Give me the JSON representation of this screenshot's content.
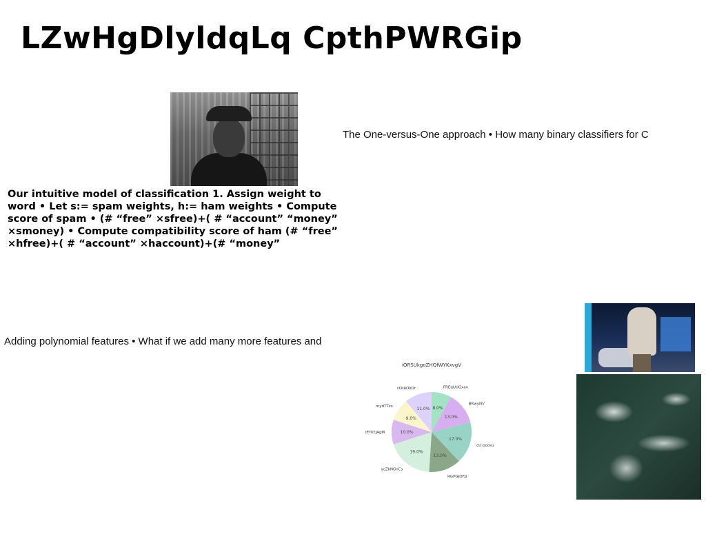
{
  "slide": {
    "title": "LZwHgDlyldqLq CpthPWRGip",
    "bold_paragraph": "Our intuitive model of classification 1. Assign weight to word • Let s:= spam weights, h:= ham weights • Compute score of spam • (# “free” ×sfree)+( # “account” “money” ×smoney) • Compute compatibility score of ham (# “free” ×hfree)+( # “account” ×haccount)+(# “money”",
    "text_ovo": "The One-versus-One approach • How many binary classifiers for C",
    "text_poly": "Adding polynomial features • What if we add many more features and"
  },
  "chart_data": {
    "type": "pie",
    "title": "iORSUkgoZHQfWYKxvgV",
    "slices": [
      {
        "label": "FREqUUGxav",
        "value": 8.0,
        "color": "#a3e3c4"
      },
      {
        "label": "BRwyNV",
        "value": 13.0,
        "color": "#d7aef0"
      },
      {
        "label": "cU  poosu",
        "value": 17.0,
        "color": "#99d3c6"
      },
      {
        "label": "RGPGJOFJJ",
        "value": 13.0,
        "color": "#8aa78a"
      },
      {
        "label": "ycZkNGnCs",
        "value": 19.0,
        "color": "#d4efdd"
      },
      {
        "label": "DFTKTJAgM",
        "value": 10.0,
        "color": "#d9b8ef"
      },
      {
        "label": "mydTTzx",
        "value": 9.0,
        "color": "#fbf5cc"
      },
      {
        "label": "cOrAOXOr",
        "value": 11.0,
        "color": "#dcd2fb"
      }
    ],
    "start_angle_deg": 90,
    "direction": "clockwise",
    "value_format": "percent_1dp"
  }
}
